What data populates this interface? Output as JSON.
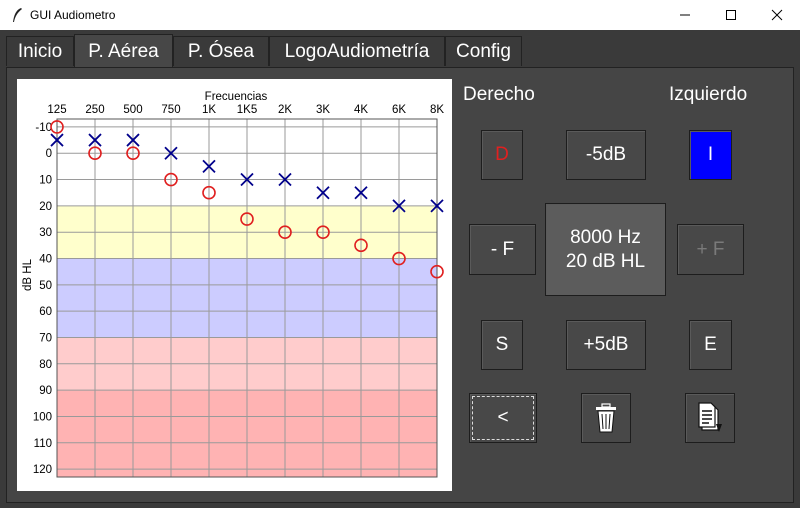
{
  "window": {
    "title": "GUI Audiometro",
    "icon": "feather-icon",
    "controls": [
      "minimize-icon",
      "maximize-icon",
      "close-icon"
    ]
  },
  "tabs": [
    {
      "label": "Inicio",
      "active": false
    },
    {
      "label": "P. Aérea",
      "active": true
    },
    {
      "label": "P. Ósea",
      "active": false
    },
    {
      "label": "LogoAudiometría",
      "active": false
    },
    {
      "label": "Config",
      "active": false
    }
  ],
  "controls": {
    "right_label": "Derecho",
    "left_label": "Izquierdo",
    "btn_right_ear": "D",
    "btn_minus_db": "-5dB",
    "btn_left_ear": "I",
    "btn_minus_f": "- F",
    "display_freq": "8000 Hz",
    "display_level": "20 dB HL",
    "btn_plus_f": "+ F",
    "btn_s": "S",
    "btn_plus_db": "+5dB",
    "btn_e": "E",
    "btn_back": "<",
    "btn_trash_icon": "trash-icon",
    "btn_report_icon": "report-icon",
    "colors": {
      "right_ear": "#e02020",
      "left_ear_selected": "#0000ff",
      "accent_dim": "#7a7a7a"
    }
  },
  "chart_data": {
    "type": "scatter",
    "title": "Frecuencias",
    "ylabel": "dB HL",
    "categories": [
      "125",
      "250",
      "500",
      "750",
      "1K",
      "1K5",
      "2K",
      "3K",
      "4K",
      "6K",
      "8K"
    ],
    "y_ticks": [
      -10,
      0,
      10,
      20,
      30,
      40,
      50,
      60,
      70,
      80,
      90,
      100,
      110,
      120
    ],
    "ylim": [
      -13,
      123
    ],
    "y_inverted": true,
    "grid": true,
    "bands": [
      {
        "from": 20,
        "to": 40,
        "color": "#ffffcc"
      },
      {
        "from": 40,
        "to": 70,
        "color": "#ccccff"
      },
      {
        "from": 70,
        "to": 90,
        "color": "#ffcccc"
      },
      {
        "from": 90,
        "to": 123,
        "color": "#ffb3b3"
      }
    ],
    "series": [
      {
        "marker": "circle",
        "color": "#e02020",
        "x": [
          "125",
          "250",
          "500",
          "750",
          "1K",
          "1K5",
          "2K",
          "3K",
          "4K",
          "6K",
          "8K"
        ],
        "values": [
          -10,
          0,
          0,
          10,
          15,
          25,
          30,
          30,
          35,
          40,
          45
        ]
      },
      {
        "marker": "x",
        "color": "#00008b",
        "x": [
          "125",
          "250",
          "500",
          "750",
          "1K",
          "1K5",
          "2K",
          "3K",
          "4K",
          "6K",
          "8K"
        ],
        "values": [
          -5,
          -5,
          -5,
          0,
          5,
          10,
          10,
          15,
          15,
          20,
          20
        ]
      }
    ]
  }
}
